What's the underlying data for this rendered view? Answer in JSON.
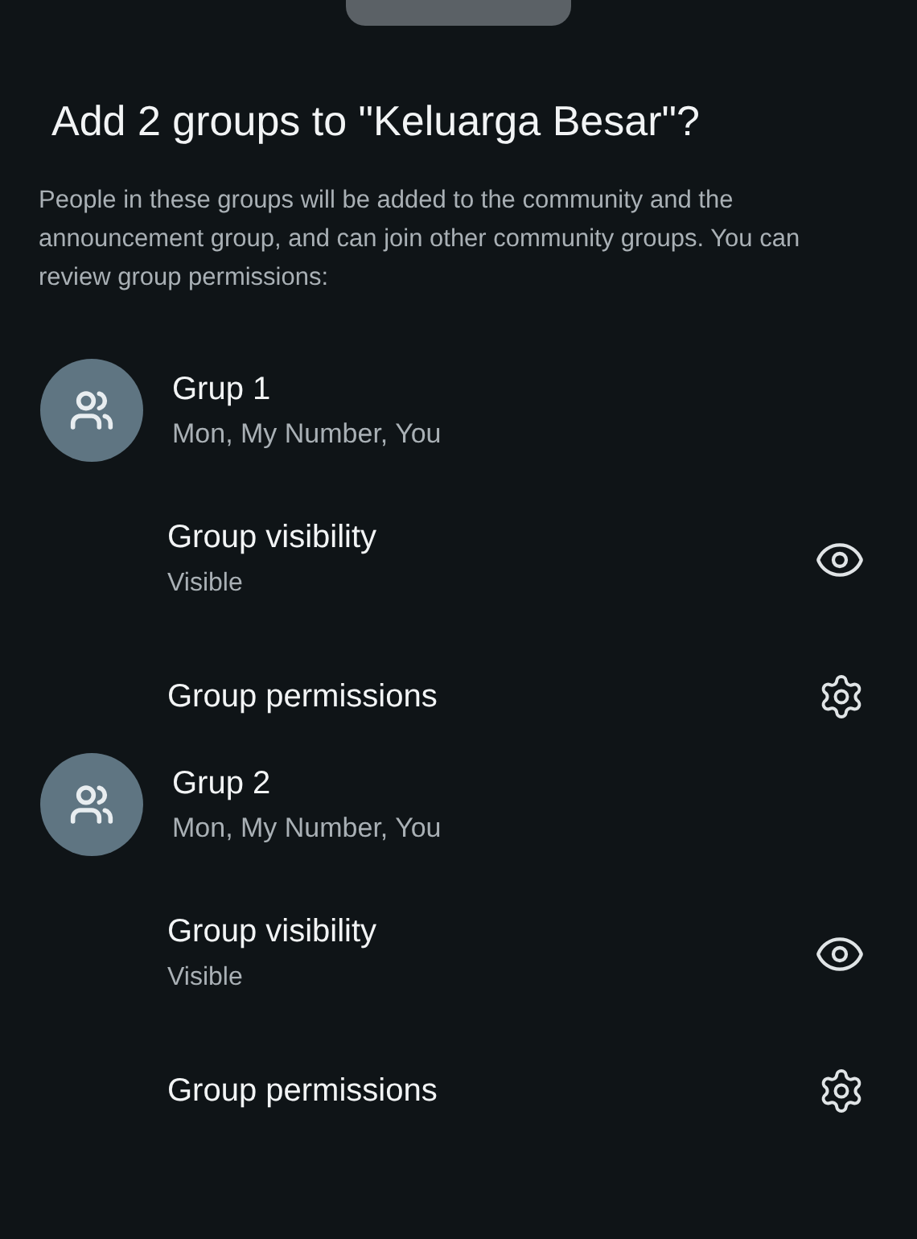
{
  "title": "Add 2 groups to \"Keluarga Besar\"?",
  "description": "People in these groups will be added to the community and the announcement group, and can join other community groups. You can review group permissions:",
  "groups": [
    {
      "name": "Grup 1",
      "members": "Mon, My Number, You",
      "settings": [
        {
          "kind": "visibility",
          "label": "Group visibility",
          "value": "Visible"
        },
        {
          "kind": "permissions",
          "label": "Group permissions"
        }
      ]
    },
    {
      "name": "Grup 2",
      "members": "Mon, My Number, You",
      "settings": [
        {
          "kind": "visibility",
          "label": "Group visibility",
          "value": "Visible"
        },
        {
          "kind": "permissions",
          "label": "Group permissions"
        }
      ]
    }
  ]
}
